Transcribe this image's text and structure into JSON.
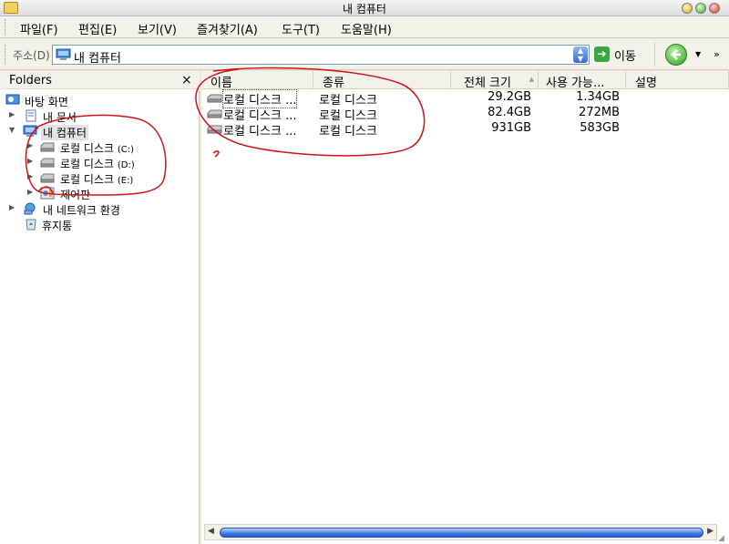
{
  "window": {
    "title": "내 컴퓨터"
  },
  "menu": [
    {
      "label": "파일(F)"
    },
    {
      "label": "편집(E)"
    },
    {
      "label": "보기(V)"
    },
    {
      "label": "즐겨찾기(A)"
    },
    {
      "label": "도구(T)"
    },
    {
      "label": "도움말(H)"
    }
  ],
  "address": {
    "label": "주소(D)",
    "value": "내 컴퓨터",
    "go_label": "이동"
  },
  "folders": {
    "title": "Folders",
    "close_glyph": "×",
    "items": [
      {
        "label": "바탕 화면"
      },
      {
        "label": "내 문서"
      },
      {
        "label": "내 컴퓨터"
      },
      {
        "label": "로컬 디스크",
        "suffix": "(C:)"
      },
      {
        "label": "로컬 디스크",
        "suffix": "(D:)"
      },
      {
        "label": "로컬 디스크",
        "suffix": "(E:)"
      },
      {
        "label": "제어판"
      },
      {
        "label": "내 네트워크 환경"
      },
      {
        "label": "휴지통"
      }
    ]
  },
  "list": {
    "columns": [
      {
        "label": "이름"
      },
      {
        "label": "종류"
      },
      {
        "label": "전체 크기"
      },
      {
        "label": "사용 가능..."
      },
      {
        "label": "설명"
      }
    ],
    "rows": [
      {
        "name": "로컬 디스크 ...",
        "type": "로컬 디스크",
        "total": "29.2GB",
        "free": "1.34GB"
      },
      {
        "name": "로컬 디스크 ...",
        "type": "로컬 디스크",
        "total": "82.4GB",
        "free": "272MB"
      },
      {
        "name": "로컬 디스크 ...",
        "type": "로컬 디스크",
        "total": "931GB",
        "free": "583GB"
      }
    ]
  },
  "colors": {
    "annotation": "#d0121b",
    "scroll_thumb": "#3b78ea"
  }
}
